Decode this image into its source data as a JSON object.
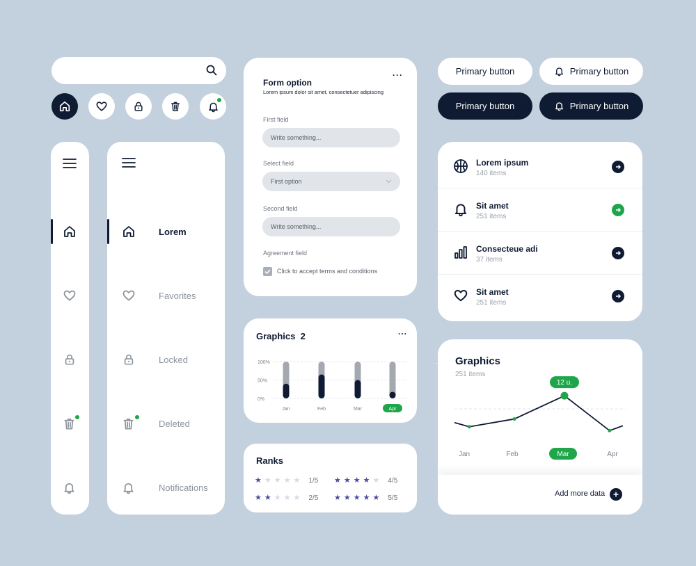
{
  "search": {
    "placeholder": "",
    "icon": "search-icon"
  },
  "quick_icons": [
    {
      "name": "home-icon",
      "active": true
    },
    {
      "name": "heart-icon",
      "active": false
    },
    {
      "name": "lock-icon",
      "active": false
    },
    {
      "name": "trash-icon",
      "active": false
    },
    {
      "name": "bell-icon",
      "active": false,
      "badge": true
    }
  ],
  "sidebar_full": {
    "items": [
      {
        "label": "Lorem",
        "icon": "home-icon",
        "active": true
      },
      {
        "label": "Favorites",
        "icon": "heart-icon",
        "active": false
      },
      {
        "label": "Locked",
        "icon": "lock-icon",
        "active": false
      },
      {
        "label": "Deleted",
        "icon": "trash-icon",
        "active": false,
        "badge": true
      },
      {
        "label": "Notifications",
        "icon": "bell-icon",
        "active": false
      }
    ]
  },
  "form": {
    "title": "Form option",
    "subtitle": "Lorem ipsum dolor sit amet, consectetuer adipiscing",
    "first_field_label": "First field",
    "first_field_placeholder": "Write something...",
    "select_label": "Select field",
    "select_value": "First option",
    "second_field_label": "Second field",
    "second_field_placeholder": "Write something...",
    "agreement_label": "Agreement field",
    "agreement_text": "Click to accept terms and conditions",
    "agreement_checked": true
  },
  "buttons": {
    "primary_label": "Primary button"
  },
  "list": {
    "items": [
      {
        "title": "Lorem ipsum",
        "subtitle": "140 items",
        "icon": "basketball-icon",
        "arrow_color": "#0f1b33"
      },
      {
        "title": "Sit amet",
        "subtitle": "251 items",
        "icon": "bell-icon",
        "arrow_color": "#1fa64a"
      },
      {
        "title": "Consecteue adi",
        "subtitle": "37 items",
        "icon": "bar-chart-icon",
        "arrow_color": "#0f1b33"
      },
      {
        "title": "Sit amet",
        "subtitle": "251 items",
        "icon": "heart-icon",
        "arrow_color": "#0f1b33"
      }
    ]
  },
  "graphics2": {
    "title": "Graphics",
    "badge": "2",
    "more": "..."
  },
  "ranks": {
    "title": "Ranks",
    "rows": [
      {
        "stars": 1,
        "label": "1/5"
      },
      {
        "stars": 4,
        "label": "4/5"
      },
      {
        "stars": 2,
        "label": "2/5"
      },
      {
        "stars": 5,
        "label": "5/5"
      }
    ]
  },
  "graphics_line": {
    "title": "Graphics",
    "subtitle": "251 items",
    "tooltip": "12 u.",
    "add_more_label": "Add more data"
  },
  "colors": {
    "accent": "#1fa64a",
    "dark": "#0f1b33",
    "background": "#c3d0de",
    "star": "#4a4a9c"
  },
  "chart_data": [
    {
      "type": "bar",
      "categories": [
        "Jan",
        "Feb",
        "Mar",
        "Apr"
      ],
      "series": [
        {
          "values": [
            40,
            65,
            50,
            18
          ]
        }
      ],
      "y_tick_labels": [
        "100%",
        "50%",
        "0%"
      ],
      "ylim": [
        0,
        100
      ],
      "highlight": "Apr"
    },
    {
      "type": "line",
      "categories": [
        "Jan",
        "Feb",
        "Mar",
        "Apr"
      ],
      "series": [
        {
          "values": [
            4,
            6,
            12,
            3
          ]
        }
      ],
      "x_points": [
        0.1,
        1,
        2,
        2.9
      ],
      "annotation": {
        "x": "Mar",
        "label": "12 u."
      },
      "highlight": "Mar",
      "ylim": [
        0,
        14
      ]
    }
  ]
}
